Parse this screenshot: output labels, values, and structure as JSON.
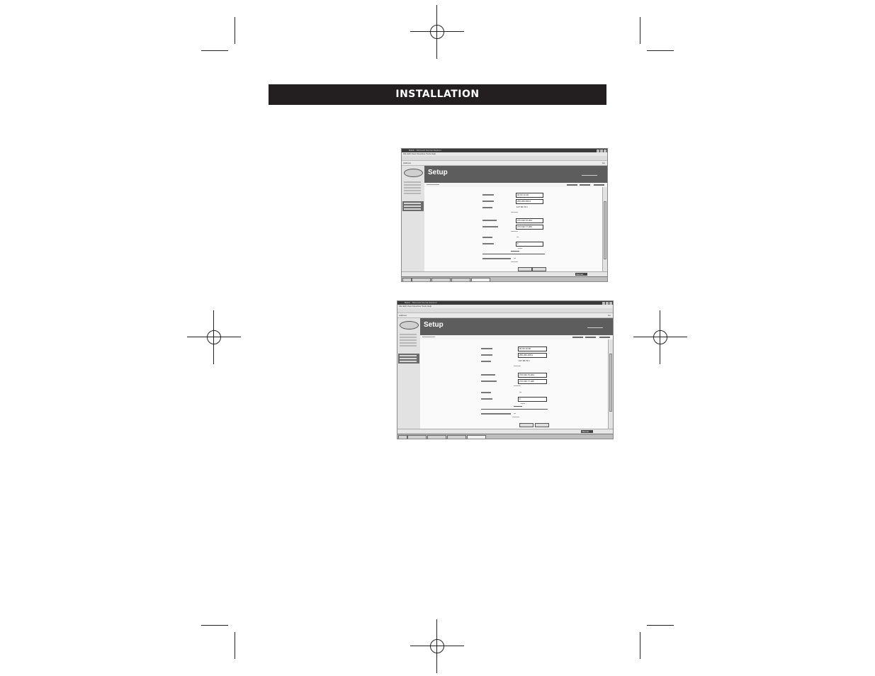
{
  "page": {
    "header_title": "INSTALLATION"
  },
  "screenshots": [
    {
      "window_title": "Belkin - Microsoft Internet Explorer",
      "menu": "File  Edit  View  Favorites  Tools  Help",
      "address": "Address",
      "go": "Go",
      "banner_title": "Setup",
      "fields": [
        "00 00 13 4D",
        "255.255.255.0",
        "127.00.72.1",
        "270.190.70.204",
        "270.190.77.205",
        "0"
      ],
      "status_zone": "Internet"
    },
    {
      "window_title": "Belkin - Microsoft Internet Explorer",
      "menu": "File  Edit  View  Favorites  Tools  Help",
      "address": "Address",
      "go": "Go",
      "banner_title": "Setup",
      "fields": [
        "00 00 13 4D",
        "255.255.255.0",
        "127.00.72.1",
        "270.190.70.204",
        "270.190.77.205",
        "0"
      ],
      "status_zone": "Internet"
    }
  ]
}
